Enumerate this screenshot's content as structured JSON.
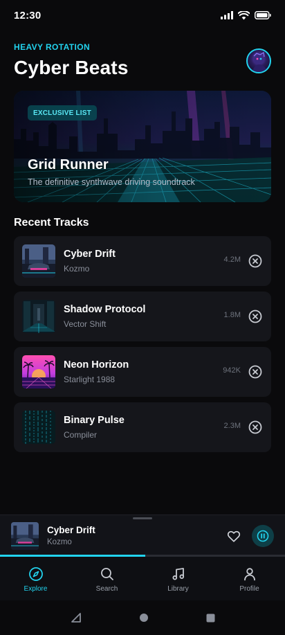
{
  "status": {
    "time": "12:30"
  },
  "header": {
    "eyebrow": "HEAVY ROTATION",
    "title": "Cyber Beats"
  },
  "hero": {
    "badge": "EXCLUSIVE LIST",
    "title": "Grid Runner",
    "subtitle": "The definitive synthwave driving soundtrack"
  },
  "section": {
    "title": "Recent Tracks"
  },
  "tracks": [
    {
      "title": "Cyber Drift",
      "artist": "Kozmo",
      "plays": "4.2M"
    },
    {
      "title": "Shadow Protocol",
      "artist": "Vector Shift",
      "plays": "1.8M"
    },
    {
      "title": "Neon Horizon",
      "artist": "Starlight 1988",
      "plays": "942K"
    },
    {
      "title": "Binary Pulse",
      "artist": "Compiler",
      "plays": "2.3M"
    }
  ],
  "now_playing": {
    "title": "Cyber Drift",
    "artist": "Kozmo",
    "progress": 0.51
  },
  "nav": [
    {
      "label": "Explore",
      "icon": "compass-icon",
      "active": true
    },
    {
      "label": "Search",
      "icon": "search-icon",
      "active": false
    },
    {
      "label": "Library",
      "icon": "music-note-icon",
      "active": false
    },
    {
      "label": "Profile",
      "icon": "user-icon",
      "active": false
    }
  ],
  "colors": {
    "accent": "#22d3ee",
    "background": "#0a0a0c",
    "card": "#15161b"
  }
}
